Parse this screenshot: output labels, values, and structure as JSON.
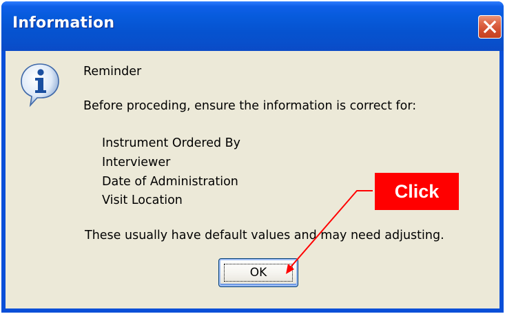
{
  "window": {
    "title": "Information",
    "close_icon": "close-icon"
  },
  "dialog": {
    "icon": "info-icon",
    "heading": "Reminder",
    "intro": "Before proceding, ensure the information is correct for:",
    "items": [
      "Instrument Ordered By",
      "Interviewer",
      "Date of Administration",
      "Visit Location"
    ],
    "note": "These usually have default values and may need adjusting.",
    "ok_label": "OK"
  },
  "annotation": {
    "label": "Click",
    "color": "#ff0000"
  },
  "colors": {
    "titlebar": "#0653d0",
    "client_bg": "#ece9d8",
    "close_button": "#cf4a2b"
  }
}
